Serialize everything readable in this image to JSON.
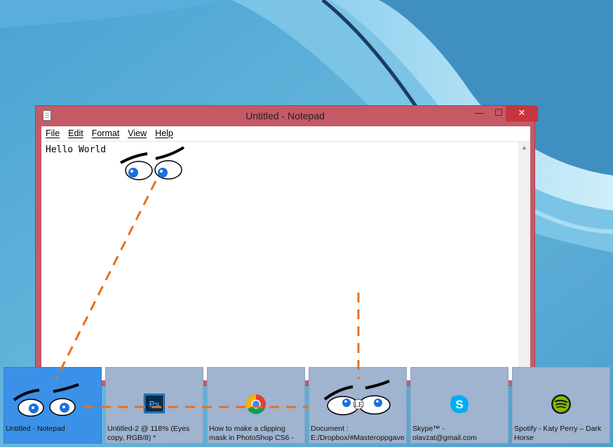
{
  "window": {
    "title": "Untitled - Notepad",
    "minimize_glyph": "—",
    "maximize_glyph": "☐",
    "close_glyph": "✕"
  },
  "menu": [
    "File",
    "Edit",
    "Format",
    "View",
    "Help"
  ],
  "editor": {
    "text": "Hello World"
  },
  "taskbar": {
    "previews": [
      {
        "label": "Untitled - Notepad",
        "icon": "googly-eyes-icon",
        "active": true
      },
      {
        "label": "Untitled-2 @ 118% (Eyes copy, RGB/8) *",
        "icon": "photoshop-icon",
        "icon_text": "Ps"
      },
      {
        "label": "How to make a clipping mask in PhotoShop CS6 -",
        "icon": "chrome-icon"
      },
      {
        "label": "Document : E:/Dropbox/#Masteroppgave",
        "icon": "googly-eyes-icon",
        "icon_text": "LE"
      },
      {
        "label": "Skype™ - olavzat@gmail.com",
        "icon": "skype-icon",
        "icon_text": "S"
      },
      {
        "label": "Spotify - Katy Perry – Dark Horse",
        "icon": "spotify-icon"
      }
    ]
  },
  "colors": {
    "window_frame": "#c55a66",
    "active_preview": "#3b91e8",
    "preview": "#a0b3cf",
    "guide_lines": "#e8701a",
    "eye_iris": "#1a6fe0"
  }
}
